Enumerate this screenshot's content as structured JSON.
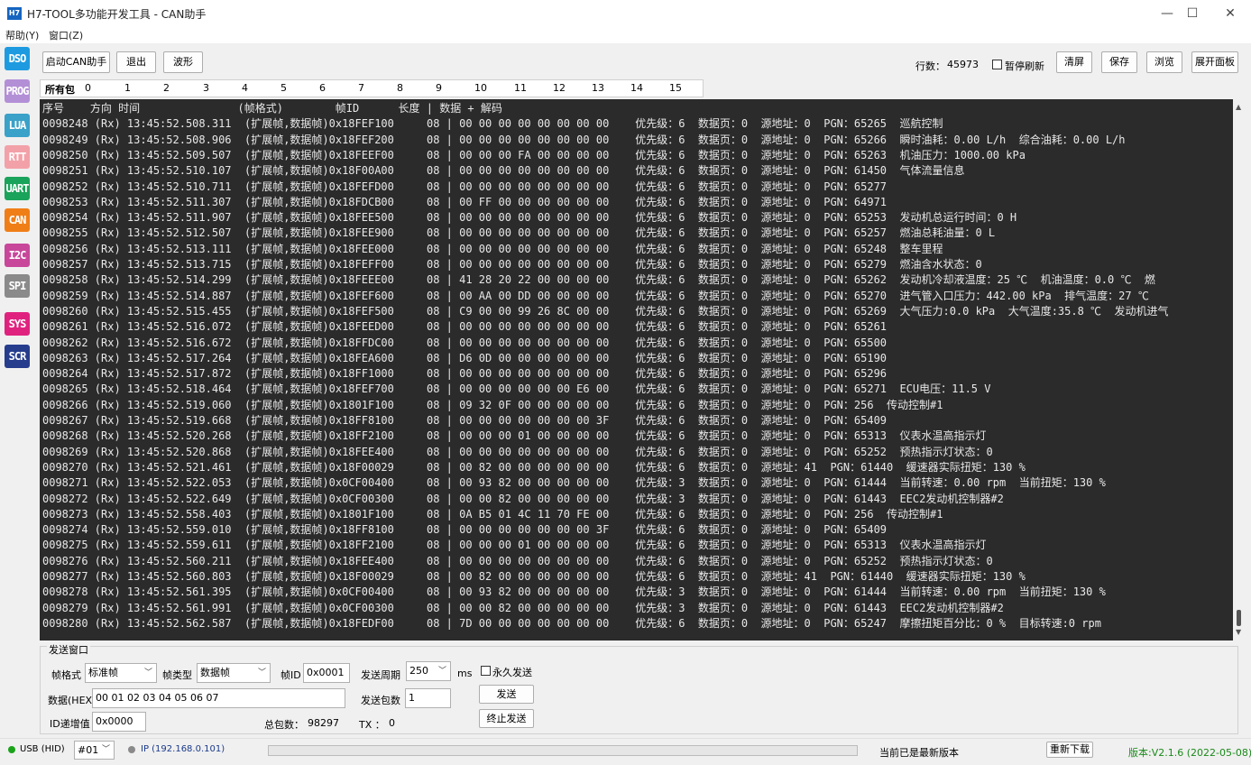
{
  "window": {
    "icon_label": "H7",
    "title": "H7-TOOL多功能开发工具 - CAN助手",
    "minimize": "—",
    "maximize": "☐",
    "close": "✕"
  },
  "menu": [
    {
      "label": "帮助(Y)"
    },
    {
      "label": "窗口(Z)"
    }
  ],
  "sidebar": [
    {
      "label": "DSO",
      "color": "#1e9be0"
    },
    {
      "label": "PROG",
      "color": "#b38fd6"
    },
    {
      "label": "LUA",
      "color": "#3aa1c8"
    },
    {
      "label": "RTT",
      "color": "#f3a1a8"
    },
    {
      "label": "UART",
      "color": "#1aa35a"
    },
    {
      "label": "CAN",
      "color": "#f07e17"
    },
    {
      "label": "I2C",
      "color": "#c8479a"
    },
    {
      "label": "SPI",
      "color": "#8a8a8a"
    },
    {
      "label": "SYS",
      "color": "#e0227f"
    },
    {
      "label": "SCR",
      "color": "#263d8e"
    }
  ],
  "toolbar": {
    "start": "启动CAN助手",
    "exit": "退出",
    "wave": "波形",
    "row_count_label": "行数：",
    "row_count": "45973",
    "pause_refresh": "暂停刷新",
    "clear": "清屏",
    "save": "保存",
    "browse": "浏览",
    "expand_panel": "展开面板"
  },
  "tabs": [
    "所有包",
    "0",
    "1",
    "2",
    "3",
    "4",
    "5",
    "6",
    "7",
    "8",
    "9",
    "10",
    "11",
    "12",
    "13",
    "14",
    "15"
  ],
  "terminal": {
    "header": "序号    方向 时间               (帧格式)        帧ID      长度 | 数据 + 解码",
    "lines": [
      "0098248 (Rx) 13:45:52.508.311  (扩展帧,数据帧)0x18FEF100     08 | 00 00 00 00 00 00 00 00    优先级：6  数据页：0  源地址：0  PGN：65265  巡航控制",
      "0098249 (Rx) 13:45:52.508.906  (扩展帧,数据帧)0x18FEF200     08 | 00 00 00 00 00 00 00 00    优先级：6  数据页：0  源地址：0  PGN：65266  瞬时油耗：0.00 L/h  综合油耗：0.00 L/h",
      "0098250 (Rx) 13:45:52.509.507  (扩展帧,数据帧)0x18FEEF00     08 | 00 00 00 FA 00 00 00 00    优先级：6  数据页：0  源地址：0  PGN：65263  机油压力：1000.00 kPa",
      "0098251 (Rx) 13:45:52.510.107  (扩展帧,数据帧)0x18F00A00     08 | 00 00 00 00 00 00 00 00    优先级：6  数据页：0  源地址：0  PGN：61450  气体流量信息",
      "0098252 (Rx) 13:45:52.510.711  (扩展帧,数据帧)0x18FEFD00     08 | 00 00 00 00 00 00 00 00    优先级：6  数据页：0  源地址：0  PGN：65277",
      "0098253 (Rx) 13:45:52.511.307  (扩展帧,数据帧)0x18FDCB00     08 | 00 FF 00 00 00 00 00 00    优先级：6  数据页：0  源地址：0  PGN：64971",
      "0098254 (Rx) 13:45:52.511.907  (扩展帧,数据帧)0x18FEE500     08 | 00 00 00 00 00 00 00 00    优先级：6  数据页：0  源地址：0  PGN：65253  发动机总运行时间：0 H",
      "0098255 (Rx) 13:45:52.512.507  (扩展帧,数据帧)0x18FEE900     08 | 00 00 00 00 00 00 00 00    优先级：6  数据页：0  源地址：0  PGN：65257  燃油总耗油量：0 L",
      "0098256 (Rx) 13:45:52.513.111  (扩展帧,数据帧)0x18FEE000     08 | 00 00 00 00 00 00 00 00    优先级：6  数据页：0  源地址：0  PGN：65248  整车里程",
      "0098257 (Rx) 13:45:52.513.715  (扩展帧,数据帧)0x18FEFF00     08 | 00 00 00 00 00 00 00 00    优先级：6  数据页：0  源地址：0  PGN：65279  燃油含水状态：0",
      "0098258 (Rx) 13:45:52.514.299  (扩展帧,数据帧)0x18FEEE00     08 | 41 28 20 22 00 00 00 00    优先级：6  数据页：0  源地址：0  PGN：65262  发动机冷却液温度：25 ℃  机油温度：0.0 ℃  燃",
      "0098259 (Rx) 13:45:52.514.887  (扩展帧,数据帧)0x18FEF600     08 | 00 AA 00 DD 00 00 00 00    优先级：6  数据页：0  源地址：0  PGN：65270  进气管入口压力：442.00 kPa  排气温度：27 ℃",
      "0098260 (Rx) 13:45:52.515.455  (扩展帧,数据帧)0x18FEF500     08 | C9 00 00 99 26 8C 00 00    优先级：6  数据页：0  源地址：0  PGN：65269  大气压力:0.0 kPa  大气温度:35.8 ℃  发动机进气",
      "0098261 (Rx) 13:45:52.516.072  (扩展帧,数据帧)0x18FEED00     08 | 00 00 00 00 00 00 00 00    优先级：6  数据页：0  源地址：0  PGN：65261",
      "0098262 (Rx) 13:45:52.516.672  (扩展帧,数据帧)0x18FFDC00     08 | 00 00 00 00 00 00 00 00    优先级：6  数据页：0  源地址：0  PGN：65500",
      "0098263 (Rx) 13:45:52.517.264  (扩展帧,数据帧)0x18FEA600     08 | D6 0D 00 00 00 00 00 00    优先级：6  数据页：0  源地址：0  PGN：65190",
      "0098264 (Rx) 13:45:52.517.872  (扩展帧,数据帧)0x18FF1000     08 | 00 00 00 00 00 00 00 00    优先级：6  数据页：0  源地址：0  PGN：65296",
      "0098265 (Rx) 13:45:52.518.464  (扩展帧,数据帧)0x18FEF700     08 | 00 00 00 00 00 00 E6 00    优先级：6  数据页：0  源地址：0  PGN：65271  ECU电压：11.5 V",
      "0098266 (Rx) 13:45:52.519.060  (扩展帧,数据帧)0x1801F100     08 | 09 32 0F 00 00 00 00 00    优先级：6  数据页：0  源地址：0  PGN：256  传动控制#1",
      "0098267 (Rx) 13:45:52.519.668  (扩展帧,数据帧)0x18FF8100     08 | 00 00 00 00 00 00 00 3F    优先级：6  数据页：0  源地址：0  PGN：65409",
      "0098268 (Rx) 13:45:52.520.268  (扩展帧,数据帧)0x18FF2100     08 | 00 00 00 01 00 00 00 00    优先级：6  数据页：0  源地址：0  PGN：65313  仪表水温高指示灯",
      "0098269 (Rx) 13:45:52.520.868  (扩展帧,数据帧)0x18FEE400     08 | 00 00 00 00 00 00 00 00    优先级：6  数据页：0  源地址：0  PGN：65252  预热指示灯状态：0",
      "0098270 (Rx) 13:45:52.521.461  (扩展帧,数据帧)0x18F00029     08 | 00 82 00 00 00 00 00 00    优先级：6  数据页：0  源地址：41  PGN：61440  缓速器实际扭矩：130 %",
      "0098271 (Rx) 13:45:52.522.053  (扩展帧,数据帧)0x0CF00400     08 | 00 93 82 00 00 00 00 00    优先级：3  数据页：0  源地址：0  PGN：61444  当前转速：0.00 rpm  当前扭矩：130 %",
      "0098272 (Rx) 13:45:52.522.649  (扩展帧,数据帧)0x0CF00300     08 | 00 00 82 00 00 00 00 00    优先级：3  数据页：0  源地址：0  PGN：61443  EEC2发动机控制器#2",
      "0098273 (Rx) 13:45:52.558.403  (扩展帧,数据帧)0x1801F100     08 | 0A B5 01 4C 11 70 FE 00    优先级：6  数据页：0  源地址：0  PGN：256  传动控制#1",
      "0098274 (Rx) 13:45:52.559.010  (扩展帧,数据帧)0x18FF8100     08 | 00 00 00 00 00 00 00 3F    优先级：6  数据页：0  源地址：0  PGN：65409",
      "0098275 (Rx) 13:45:52.559.611  (扩展帧,数据帧)0x18FF2100     08 | 00 00 00 01 00 00 00 00    优先级：6  数据页：0  源地址：0  PGN：65313  仪表水温高指示灯",
      "0098276 (Rx) 13:45:52.560.211  (扩展帧,数据帧)0x18FEE400     08 | 00 00 00 00 00 00 00 00    优先级：6  数据页：0  源地址：0  PGN：65252  预热指示灯状态：0",
      "0098277 (Rx) 13:45:52.560.803  (扩展帧,数据帧)0x18F00029     08 | 00 82 00 00 00 00 00 00    优先级：6  数据页：0  源地址：41  PGN：61440  缓速器实际扭矩：130 %",
      "0098278 (Rx) 13:45:52.561.395  (扩展帧,数据帧)0x0CF00400     08 | 00 93 82 00 00 00 00 00    优先级：3  数据页：0  源地址：0  PGN：61444  当前转速：0.00 rpm  当前扭矩：130 %",
      "0098279 (Rx) 13:45:52.561.991  (扩展帧,数据帧)0x0CF00300     08 | 00 00 82 00 00 00 00 00    优先级：3  数据页：0  源地址：0  PGN：61443  EEC2发动机控制器#2",
      "0098280 (Rx) 13:45:52.562.587  (扩展帧,数据帧)0x18FEDF00     08 | 7D 00 00 00 00 00 00 00    优先级：6  数据页：0  源地址：0  PGN：65247  摩擦扭矩百分比：0 %  目标转速:0 rpm"
    ]
  },
  "send_panel": {
    "title": "发送窗口",
    "frame_format_label": "帧格式",
    "frame_format_value": "标准帧",
    "frame_type_label": "帧类型",
    "frame_type_value": "数据帧",
    "frame_id_label": "帧ID",
    "frame_id_value": "0x0001",
    "period_label": "发送周期",
    "period_value": "250",
    "period_unit": "ms",
    "forever_label": "永久发送",
    "data_label": "数据(HEX)",
    "data_value": "00 01 02 03 04 05 06 07",
    "send_count_label": "发送包数",
    "send_count_value": "1",
    "send_button": "发送",
    "stop_button": "终止发送",
    "id_inc_label": "ID递增值",
    "id_inc_value": "0x0000",
    "total_label": "总包数：",
    "total_value": "98297",
    "tx_label": "TX ：",
    "tx_value": "0"
  },
  "status": {
    "usb_label": "USB (HID)",
    "usb_color": "#1aa31a",
    "device_value": "#01",
    "ip_label": "IP (192.168.0.101)",
    "ip_color": "#8a8a8a",
    "update_status": "当前已是最新版本",
    "redownload": "重新下载",
    "version": "版本:V2.1.6 (2022-05-08)",
    "version_color": "#1a8a1a"
  },
  "icons": {
    "dropdown": "chevron-down-icon",
    "scroll_up": "scroll-up-icon",
    "scroll_down": "scroll-down-icon"
  }
}
